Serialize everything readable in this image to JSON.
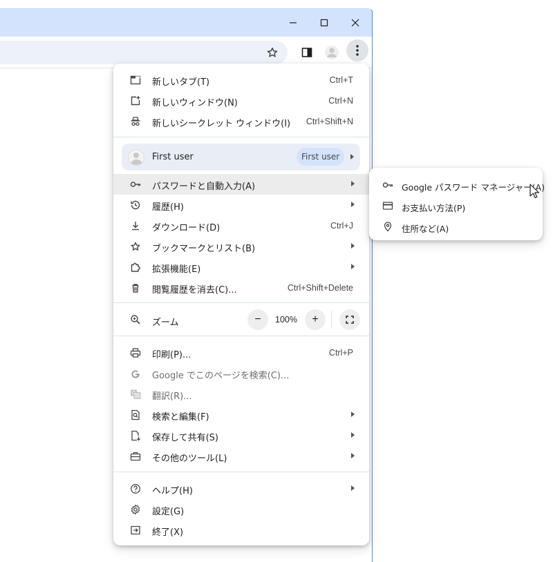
{
  "window": {
    "controls": [
      "minimize",
      "maximize",
      "close"
    ]
  },
  "toolbar": {
    "icons": [
      "star-icon",
      "side-panel-icon",
      "profile-icon",
      "more-vert-icon"
    ]
  },
  "menu": {
    "group1": [
      {
        "label": "新しいタブ(T)",
        "shortcut": "Ctrl+T",
        "icon": "new-tab-icon"
      },
      {
        "label": "新しいウィンドウ(N)",
        "shortcut": "Ctrl+N",
        "icon": "new-window-icon"
      },
      {
        "label": "新しいシークレット ウィンドウ(I)",
        "shortcut": "Ctrl+Shift+N",
        "icon": "incognito-icon"
      }
    ],
    "profile": {
      "name": "First user",
      "badge": "First user"
    },
    "group2": [
      {
        "label": "パスワードと自動入力(A)",
        "shortcut": "",
        "icon": "key-icon",
        "submenu": true
      },
      {
        "label": "履歴(H)",
        "shortcut": "",
        "icon": "history-icon",
        "submenu": true
      },
      {
        "label": "ダウンロード(D)",
        "shortcut": "Ctrl+J",
        "icon": "download-icon"
      },
      {
        "label": "ブックマークとリスト(B)",
        "shortcut": "",
        "icon": "star-icon",
        "submenu": true
      },
      {
        "label": "拡張機能(E)",
        "shortcut": "",
        "icon": "extension-icon",
        "submenu": true
      },
      {
        "label": "閲覧履歴を消去(C)...",
        "shortcut": "Ctrl+Shift+Delete",
        "icon": "trash-icon"
      }
    ],
    "zoom": {
      "label": "ズーム",
      "minus": "−",
      "value": "100%",
      "plus": "+"
    },
    "group3": [
      {
        "label": "印刷(P)...",
        "shortcut": "Ctrl+P",
        "icon": "print-icon"
      },
      {
        "label": "Google でこのページを検索(C)...",
        "shortcut": "",
        "icon": "google-icon",
        "disabled": true
      },
      {
        "label": "翻訳(R)...",
        "shortcut": "",
        "icon": "translate-icon",
        "disabled": true
      },
      {
        "label": "検索と編集(F)",
        "shortcut": "",
        "icon": "find-icon",
        "submenu": true
      },
      {
        "label": "保存して共有(S)",
        "shortcut": "",
        "icon": "save-share-icon",
        "submenu": true
      },
      {
        "label": "その他のツール(L)",
        "shortcut": "",
        "icon": "toolbox-icon",
        "submenu": true
      }
    ],
    "group4": [
      {
        "label": "ヘルプ(H)",
        "shortcut": "",
        "icon": "help-icon",
        "submenu": true
      },
      {
        "label": "設定(G)",
        "shortcut": "",
        "icon": "settings-icon"
      },
      {
        "label": "終了(X)",
        "shortcut": "",
        "icon": "exit-icon"
      }
    ]
  },
  "submenu": {
    "items": [
      {
        "label": "Google パスワード マネージャー(A)",
        "icon": "key-icon"
      },
      {
        "label": "お支払い方法(P)",
        "icon": "credit-card-icon"
      },
      {
        "label": "住所など(A)",
        "icon": "location-pin-icon"
      }
    ]
  },
  "colors": {
    "titlebar": "#d3e3fd",
    "highlight": "#ececec",
    "profile_row": "#e9eef6",
    "badge": "#d3e3fd"
  }
}
